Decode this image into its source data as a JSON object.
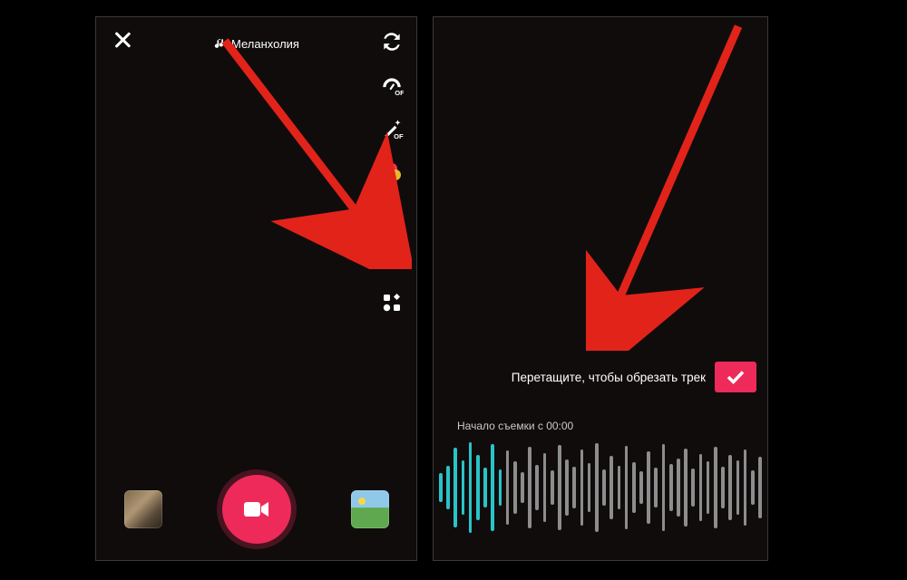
{
  "left": {
    "sound_name": "Меланхолия",
    "tools": {
      "flip": "flip-camera",
      "speed": "speed-off",
      "beauty": "beauty",
      "filters": "filters",
      "timer": "timer-3s",
      "trim_sound": "sound-trim",
      "more": "more-grid"
    }
  },
  "right": {
    "trim_instruction": "Перетащите, чтобы обрезать трек",
    "start_label": "Начало съемки с 00:00",
    "waveform": {
      "bars": [
        32,
        48,
        88,
        60,
        100,
        72,
        44,
        96,
        40,
        82,
        58,
        34,
        90,
        50,
        76,
        38,
        94,
        62,
        46,
        84,
        54,
        98,
        40,
        70,
        48,
        92,
        56,
        36,
        80,
        44,
        96,
        52,
        64,
        86,
        42,
        74,
        58,
        90,
        46,
        72,
        60,
        84,
        38,
        68
      ],
      "active_count": 9
    }
  },
  "colors": {
    "accent": "#ee2a5a",
    "wave_active": "#29c3c8",
    "arrow": "#e2231a"
  }
}
